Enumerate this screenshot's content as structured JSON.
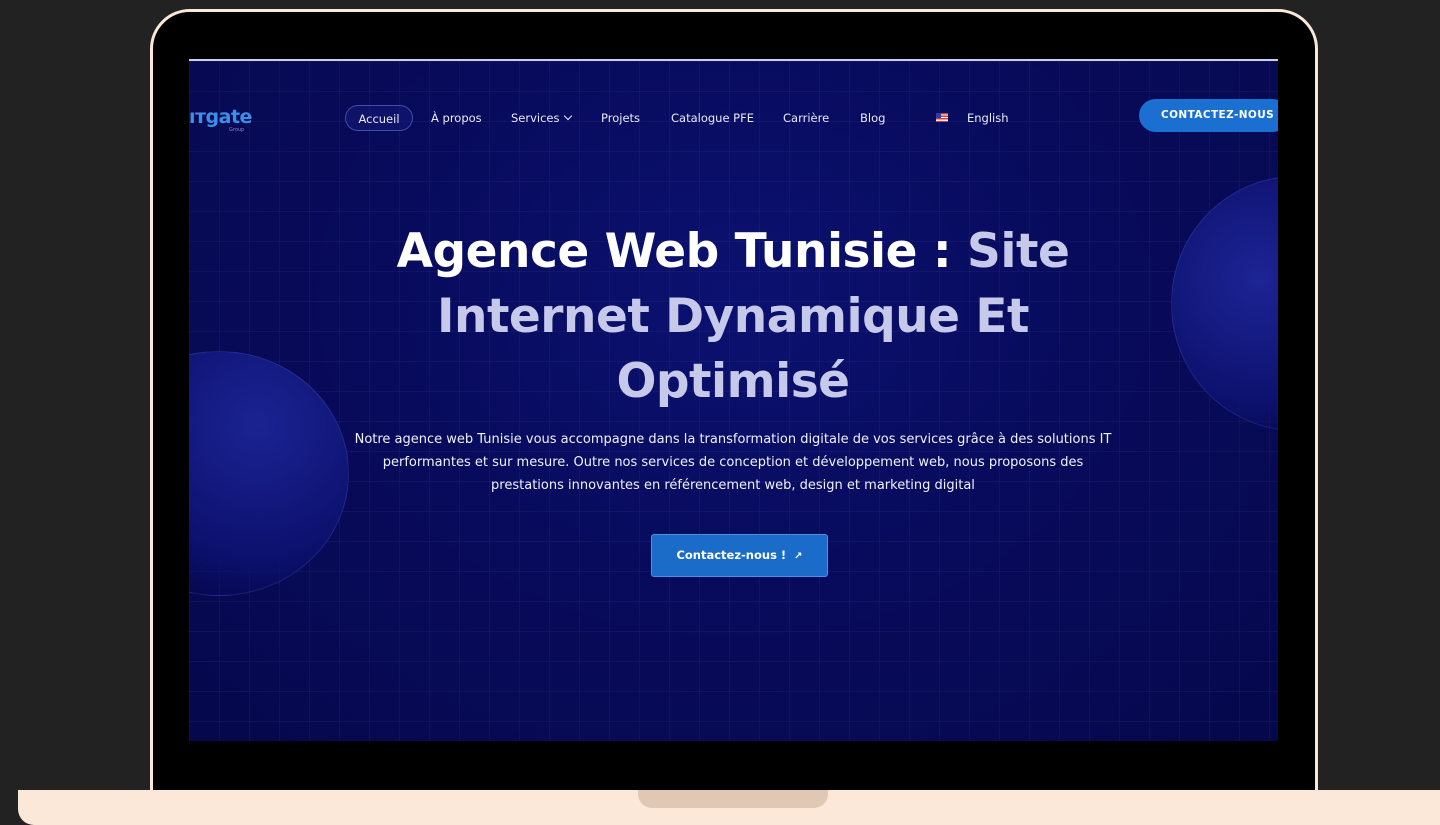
{
  "logo": {
    "text": "ıтgate",
    "sub": "Group"
  },
  "nav": {
    "items": [
      "Accueil",
      "À propos",
      "Services",
      "Projets",
      "Catalogue PFE",
      "Carrière",
      "Blog"
    ],
    "language": "English",
    "cta": "CONTACTEZ-NOUS !"
  },
  "hero": {
    "title_main": "Agence Web Tunisie : ",
    "title_accent": "Site Internet Dynamique Et Optimisé",
    "description": "Notre agence web Tunisie vous accompagne dans la transformation digitale de vos services grâce à des solutions IT performantes et sur mesure. Outre nos services de conception et développement web, nous proposons des prestations innovantes en référencement web, design et marketing digital",
    "cta": "Contactez-nous !",
    "cta_icon": "arrow-up-right-icon"
  },
  "colors": {
    "background": "#080b5c",
    "accent": "#1a6fd0",
    "logo": "#3b8fe6",
    "frame": "#fbe8d8"
  }
}
